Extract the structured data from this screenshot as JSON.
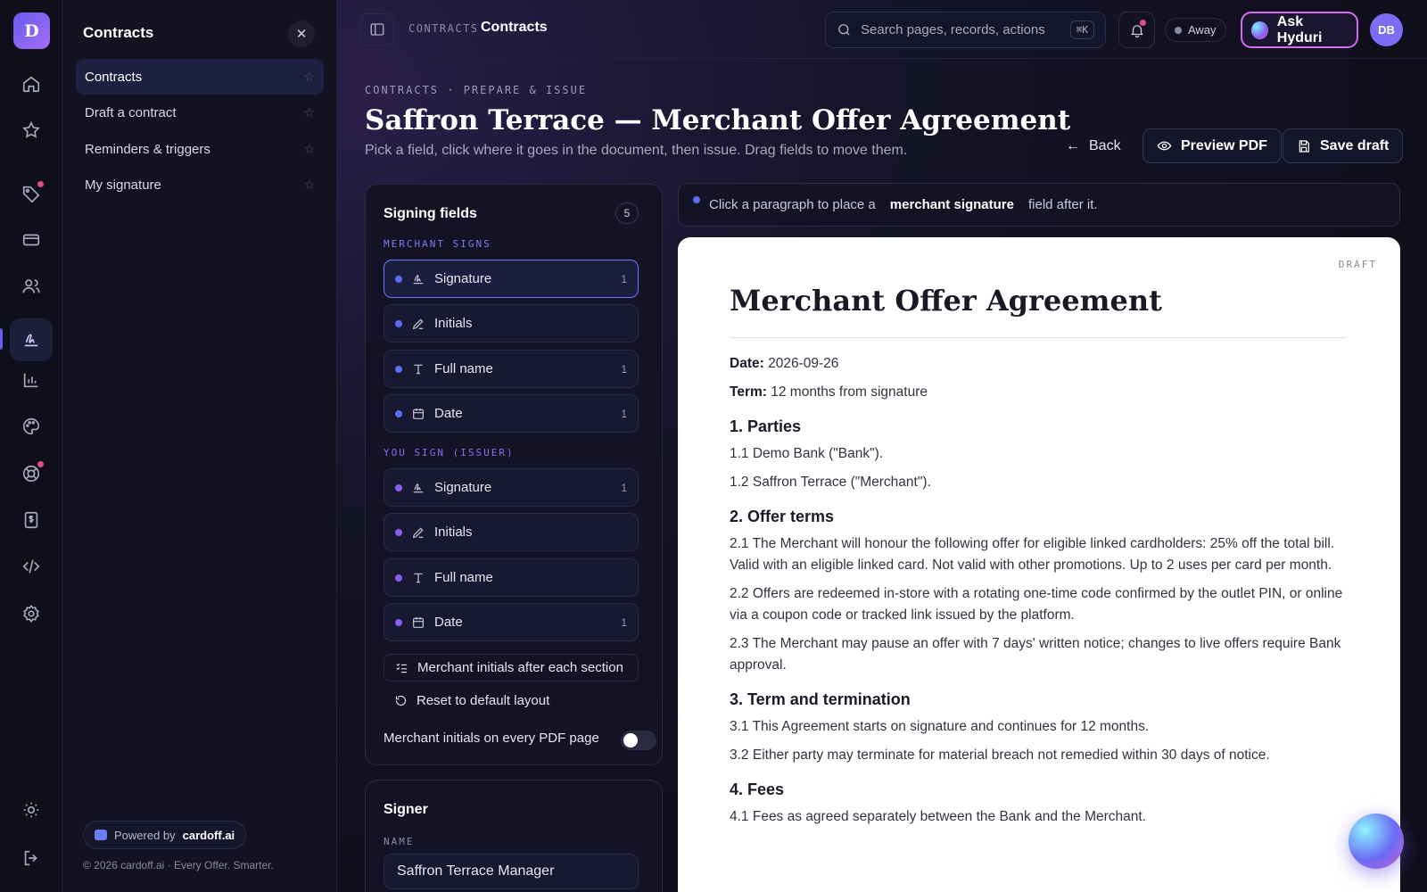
{
  "app": {
    "logo_letter": "D"
  },
  "subnav": {
    "title": "Contracts",
    "items": [
      {
        "label": "Contracts"
      },
      {
        "label": "Draft a contract"
      },
      {
        "label": "Reminders & triggers"
      },
      {
        "label": "My signature"
      }
    ],
    "powered_prefix": "Powered by",
    "powered_brand": "cardoff.ai",
    "copyright": "© 2026 cardoff.ai · Every Offer. Smarter."
  },
  "topbar": {
    "crumb_small": "CONTRACTS",
    "crumb_main": "Contracts",
    "search_placeholder": "Search pages, records, actions",
    "search_shortcut": "⌘K",
    "status": "Away",
    "ask_label": "Ask Hyduri",
    "avatar_initials": "DB"
  },
  "page": {
    "eyebrow": "CONTRACTS · PREPARE & ISSUE",
    "title": "Saffron Terrace — Merchant Offer Agreement",
    "subtitle": "Pick a field, click where it goes in the document, then issue. Drag fields to move them.",
    "back_label": "Back",
    "preview_label": "Preview PDF",
    "save_label": "Save draft"
  },
  "fields": {
    "title": "Signing fields",
    "count": "5",
    "merchant_group": "MERCHANT SIGNS",
    "issuer_group": "YOU SIGN (ISSUER)",
    "merchant": [
      {
        "label": "Signature",
        "count": "1"
      },
      {
        "label": "Initials",
        "count": ""
      },
      {
        "label": "Full name",
        "count": "1"
      },
      {
        "label": "Date",
        "count": "1"
      }
    ],
    "issuer": [
      {
        "label": "Signature",
        "count": "1"
      },
      {
        "label": "Initials",
        "count": ""
      },
      {
        "label": "Full name",
        "count": ""
      },
      {
        "label": "Date",
        "count": "1"
      }
    ],
    "initials_after_section": "Merchant initials after each section",
    "reset_layout": "Reset to default layout",
    "initials_every_page": "Merchant initials on every PDF page",
    "merchant_color": "#5a6cf2",
    "issuer_color": "#8a5cf0"
  },
  "signer": {
    "title": "Signer",
    "name_label": "NAME",
    "name_value": "Saffron Terrace Manager"
  },
  "hint": {
    "prefix": "Click a paragraph to place a",
    "field": "merchant signature",
    "suffix": "field after it."
  },
  "document": {
    "badge": "DRAFT",
    "title": "Merchant Offer Agreement",
    "date_label": "Date:",
    "date_value": "2026-09-26",
    "term_label": "Term:",
    "term_value": "12 months from signature",
    "s1_title": "1. Parties",
    "s1_p1": "1.1 Demo Bank (\"Bank\").",
    "s1_p2": "1.2 Saffron Terrace (\"Merchant\").",
    "s2_title": "2. Offer terms",
    "s2_p1": "2.1 The Merchant will honour the following offer for eligible linked cardholders: 25% off the total bill. Valid with an eligible linked card. Not valid with other promotions. Up to 2 uses per card per month.",
    "s2_p2": "2.2 Offers are redeemed in-store with a rotating one-time code confirmed by the outlet PIN, or online via a coupon code or tracked link issued by the platform.",
    "s2_p3": "2.3 The Merchant may pause an offer with 7 days' written notice; changes to live offers require Bank approval.",
    "s3_title": "3. Term and termination",
    "s3_p1": "3.1 This Agreement starts on signature and continues for 12 months.",
    "s3_p2": "3.2 Either party may terminate for material breach not remedied within 30 days of notice.",
    "s4_title": "4. Fees",
    "s4_p1": "4.1 Fees as agreed separately between the Bank and the Merchant."
  }
}
